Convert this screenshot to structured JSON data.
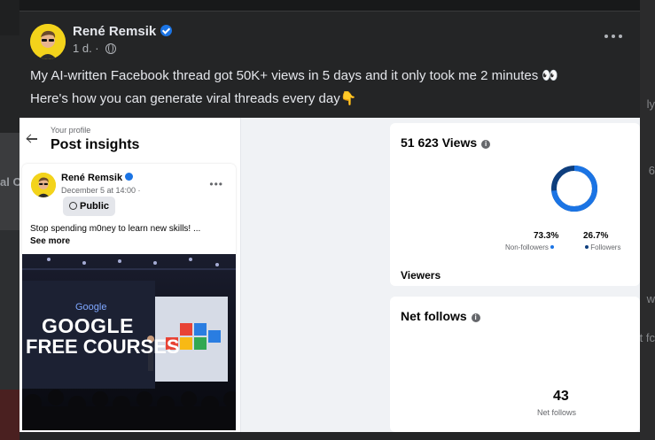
{
  "post": {
    "author": "René Remsik",
    "time": "1 d.",
    "line1": "My AI-written Facebook thread got 50K+ views in 5 days and it only took me 2 minutes 👀",
    "line2": "Here's how you can generate viral threads every day👇"
  },
  "background": {
    "left_fragment": "al C",
    "right_fragment_1": "ly",
    "right_fragment_2": "6",
    "right_fragment_3": "w",
    "right_fragment_4": "t fc"
  },
  "insights": {
    "breadcrumb": "Your profile",
    "title": "Post insights",
    "inner_post": {
      "author": "René Remsik",
      "date": "December 5 at 14:00 ·",
      "audience": "Public",
      "text": "Stop spending m0ney to learn new skills! ...",
      "see_more": "See more",
      "image_text_1": "GOOGLE",
      "image_text_2": "FREE COURSES",
      "image_logo": "Google"
    }
  },
  "views": {
    "title": "51 623 Views",
    "non_followers_pct": "73.3%",
    "non_followers_label": "Non-followers",
    "followers_pct": "26.7%",
    "followers_label": "Followers",
    "viewers_label": "Viewers",
    "non_followers_fraction": 0.733,
    "colors": {
      "non_followers": "#1b74e4",
      "followers": "#0e3e7d"
    }
  },
  "follows": {
    "title": "Net follows",
    "count": "43",
    "count_label": "Net follows"
  }
}
